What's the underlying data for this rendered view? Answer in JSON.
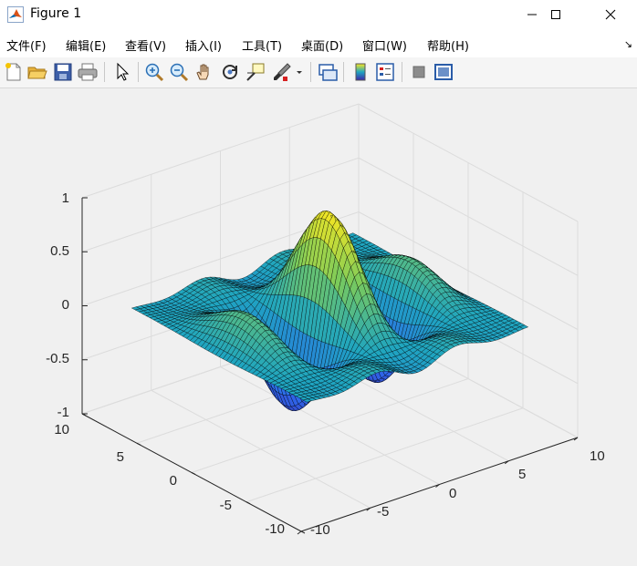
{
  "window": {
    "title": "Figure 1",
    "app_icon": "matlab-icon",
    "buttons": [
      "minimize-icon",
      "maximize-icon",
      "close-icon"
    ]
  },
  "menubar": {
    "items": [
      "文件(F)",
      "编辑(E)",
      "查看(V)",
      "插入(I)",
      "工具(T)",
      "桌面(D)",
      "窗口(W)",
      "帮助(H)"
    ],
    "dock_arrow": "↘"
  },
  "toolbar": {
    "icons": [
      "new-figure-icon",
      "open-file-icon",
      "save-icon",
      "print-icon",
      "select-arrow-icon",
      "zoom-in-icon",
      "zoom-out-icon",
      "pan-hand-icon",
      "rotate-3d-icon",
      "data-cursor-icon",
      "brush-icon",
      "link-plot-icon",
      "colorbar-icon",
      "legend-icon",
      "hide-plot-tools-icon",
      "show-plot-tools-icon"
    ]
  },
  "axes": {
    "z_ticks": [
      "1",
      "0.5",
      "0",
      "-0.5",
      "-1"
    ],
    "y_ticks": [
      "10",
      "5",
      "0",
      "-5",
      "-10"
    ],
    "x_ticks": [
      "-10",
      "-5",
      "0",
      "5",
      "10"
    ],
    "xlim": [
      -10,
      10
    ],
    "ylim": [
      -10,
      10
    ],
    "zlim": [
      -1,
      1
    ],
    "grid": true,
    "box": false
  },
  "chart_data": {
    "type": "surface",
    "colormap": "parula",
    "x_range": [
      -8,
      8
    ],
    "y_range": [
      -8,
      8
    ],
    "z_range": [
      -1,
      1
    ],
    "peaks": 3,
    "troughs": 2,
    "colors": {
      "low": "#3e26a8",
      "mid": "#1fa5c0",
      "high": "#f9e721",
      "mesh": "#000000"
    }
  }
}
